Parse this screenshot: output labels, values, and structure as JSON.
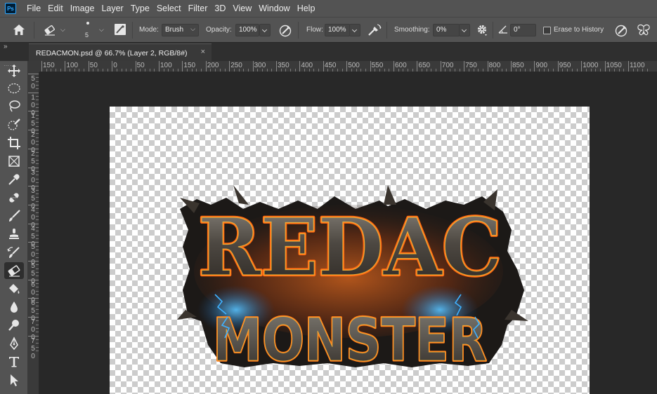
{
  "app": {
    "logo": "Ps",
    "menu": [
      "File",
      "Edit",
      "Image",
      "Layer",
      "Type",
      "Select",
      "Filter",
      "3D",
      "View",
      "Window",
      "Help"
    ]
  },
  "options": {
    "brush_size": "5",
    "mode_label": "Mode:",
    "mode_value": "Brush",
    "opacity_label": "Opacity:",
    "opacity_value": "100%",
    "flow_label": "Flow:",
    "flow_value": "100%",
    "smoothing_label": "Smoothing:",
    "smoothing_value": "0%",
    "angle_value": "0°",
    "erase_to_history_label": "Erase to History",
    "erase_to_history_checked": false
  },
  "tabs": {
    "collapse_glyph": "»",
    "document_title": "REDACMON.psd @ 66.7% (Layer 2, RGB/8#)",
    "close_glyph": "×"
  },
  "toolbar": {
    "tools": [
      "move-icon",
      "marquee-icon",
      "lasso-icon",
      "quick-selection-icon",
      "crop-icon",
      "frame-icon",
      "eyedropper-icon",
      "healing-brush-icon",
      "brush-icon",
      "clone-stamp-icon",
      "history-brush-icon",
      "eraser-icon",
      "paint-bucket-icon",
      "blur-icon",
      "dodge-icon",
      "pen-icon",
      "type-icon",
      "path-selection-icon"
    ],
    "active_tool": "eraser-icon"
  },
  "rulers": {
    "top_labels": [
      "150",
      "100",
      "50",
      "0",
      "50",
      "100",
      "150",
      "200",
      "250",
      "300",
      "350",
      "400",
      "450",
      "500",
      "550",
      "600",
      "650",
      "700",
      "750",
      "800",
      "850",
      "900",
      "950",
      "1000",
      "1050",
      "1100"
    ],
    "left_labels": [
      "5 0",
      "1 0 0",
      "1 5 0",
      "2 0 0",
      "2 5 0",
      "3 0 0",
      "3 5 0",
      "4 0 0",
      "4 5 0",
      "5 0 0",
      "5 5 0",
      "6 0 0",
      "6 5 0",
      "7 0 0",
      "7 5 0"
    ]
  },
  "artwork": {
    "line1": "REDAC",
    "line2": "MONSTER",
    "colors": {
      "metal": "#5b5750",
      "metal_dark": "#26221e",
      "glow": "#ff6a12",
      "glow_core": "#ffc23a",
      "electric": "#3fb1ff"
    }
  }
}
